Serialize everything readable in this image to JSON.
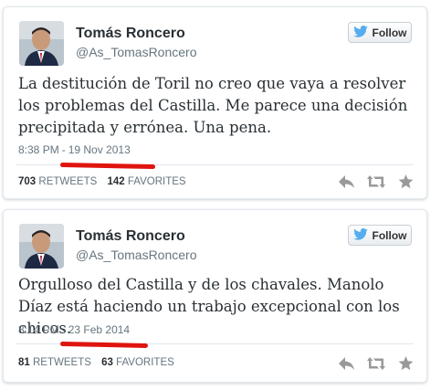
{
  "tweets": [
    {
      "author": {
        "name": "Tomás Roncero",
        "handle": "@As_TomasRoncero"
      },
      "follow_label": "Follow",
      "text": "La destitución de Toril no creo que vaya a resolver los problemas del Castilla. Me parece una decisión precipitada y errónea. Una pena.",
      "time": "8:38 PM",
      "separator": "-",
      "date": "19 Nov 2013",
      "retweets_count": "703",
      "retweets_label": "RETWEETS",
      "favorites_count": "142",
      "favorites_label": "FAVORITES"
    },
    {
      "author": {
        "name": "Tomás Roncero",
        "handle": "@As_TomasRoncero"
      },
      "follow_label": "Follow",
      "text": "Orgulloso del Castilla y de los chavales. Manolo Díaz está haciendo un trabajo excepcional con los chicos.",
      "time": "8:14 PM",
      "separator": "-",
      "date": "23 Feb 2014",
      "retweets_count": "81",
      "retweets_label": "RETWEETS",
      "favorites_count": "63",
      "favorites_label": "FAVORITES"
    }
  ],
  "icons": {
    "bird": "twitter-bird-icon",
    "reply": "reply-icon",
    "retweet": "retweet-icon",
    "favorite": "star-icon"
  },
  "colors": {
    "twitter_blue": "#55acee",
    "annotation_red": "#e0140f",
    "text": "#292f33",
    "muted": "#66757f"
  }
}
